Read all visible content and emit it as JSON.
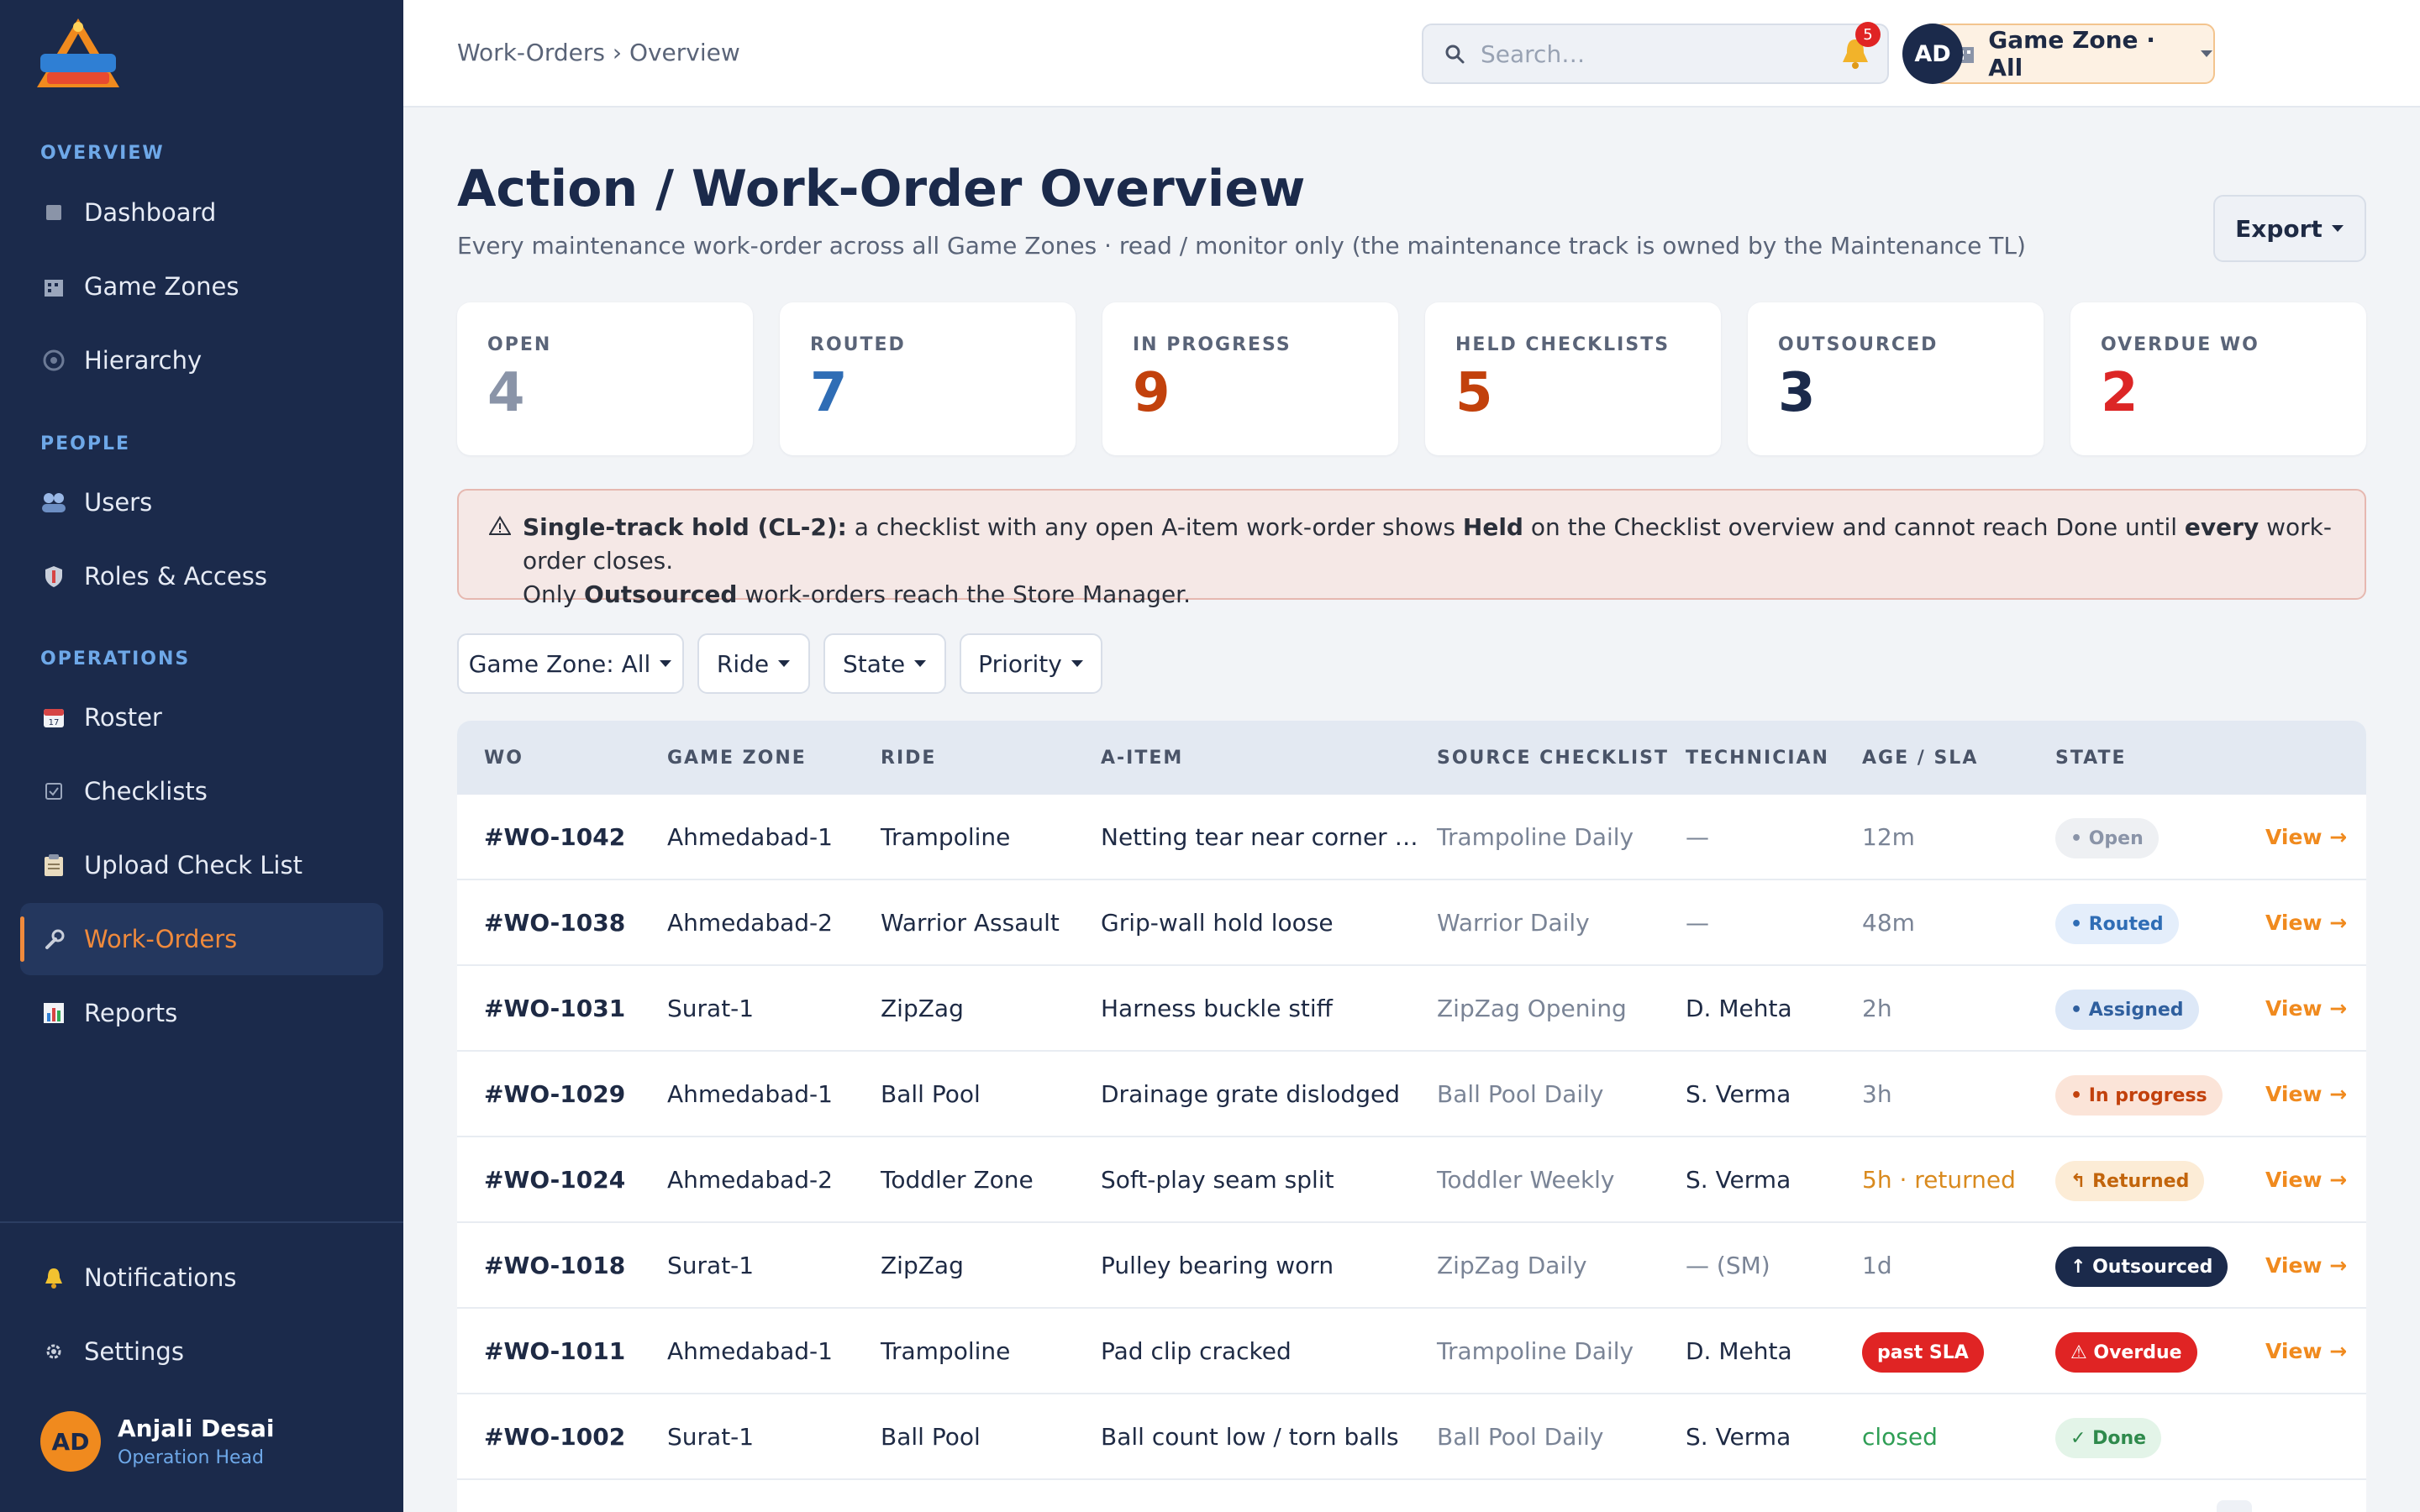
{
  "sidebar": {
    "sections": [
      {
        "title": "OVERVIEW"
      },
      {
        "title": "PEOPLE"
      },
      {
        "title": "OPERATIONS"
      }
    ],
    "items": [
      {
        "label": "Dashboard",
        "icon": "dashboard-icon"
      },
      {
        "label": "Game Zones",
        "icon": "building-icon"
      },
      {
        "label": "Hierarchy",
        "icon": "hierarchy-icon"
      },
      {
        "label": "Users",
        "icon": "users-icon"
      },
      {
        "label": "Roles & Access",
        "icon": "shield-icon"
      },
      {
        "label": "Roster",
        "icon": "calendar-icon"
      },
      {
        "label": "Checklists",
        "icon": "checkbox-icon"
      },
      {
        "label": "Upload Check List",
        "icon": "clipboard-icon"
      },
      {
        "label": "Work-Orders",
        "icon": "wrench-icon",
        "active": true
      },
      {
        "label": "Reports",
        "icon": "bar-chart-icon"
      }
    ],
    "bottom_items": [
      {
        "label": "Notifications",
        "icon": "bell-icon"
      },
      {
        "label": "Settings",
        "icon": "gear-icon"
      }
    ],
    "user": {
      "initials": "AD",
      "name": "Anjali Desai",
      "role": "Operation Head"
    }
  },
  "topbar": {
    "breadcrumb": "Work-Orders › Overview",
    "search_placeholder": "Search…",
    "zone_select": "Game Zone · All",
    "notification_count": "5",
    "avatar_initials": "AD"
  },
  "header": {
    "title": "Action / Work-Order Overview",
    "subtitle": "Every maintenance work-order across all Game Zones · read / monitor only (the maintenance track is owned by the Maintenance TL)",
    "export_label": "Export"
  },
  "stats": [
    {
      "label": "OPEN",
      "value": "4",
      "color": "#8a94a8"
    },
    {
      "label": "ROUTED",
      "value": "7",
      "color": "#2f6db5"
    },
    {
      "label": "IN PROGRESS",
      "value": "9",
      "color": "#c2410c"
    },
    {
      "label": "HELD CHECKLISTS",
      "value": "5",
      "color": "#c2410c"
    },
    {
      "label": "OUTSOURCED",
      "value": "3",
      "color": "#1b2a4b"
    },
    {
      "label": "OVERDUE WO",
      "value": "2",
      "color": "#dc2626"
    }
  ],
  "alert": {
    "bold1": "Single-track hold (CL-2):",
    "text1": " a checklist with any open A-item work-order shows ",
    "bold2": "Held",
    "text2": " on the Checklist overview and cannot reach Done until ",
    "bold3": "every",
    "text3": " work-order closes.",
    "text4": "Only ",
    "bold4": "Outsourced",
    "text5": " work-orders reach the Store Manager."
  },
  "filters": [
    {
      "label": "Game Zone: All"
    },
    {
      "label": "Ride"
    },
    {
      "label": "State"
    },
    {
      "label": "Priority"
    }
  ],
  "table": {
    "headers": [
      "WO",
      "GAME ZONE",
      "RIDE",
      "A-ITEM",
      "SOURCE CHECKLIST",
      "TECHNICIAN",
      "AGE / SLA",
      "STATE"
    ],
    "view_label": "View →",
    "rows": [
      {
        "wo": "#WO-1042",
        "zone": "Ahmedabad-1",
        "ride": "Trampoline",
        "item": "Netting tear near corner …",
        "source": "Trampoline Daily",
        "tech": "—",
        "age": "12m",
        "age_style": "plain",
        "state": "• Open",
        "state_style": "open"
      },
      {
        "wo": "#WO-1038",
        "zone": "Ahmedabad-2",
        "ride": "Warrior Assault",
        "item": "Grip-wall hold loose",
        "source": "Warrior Daily",
        "tech": "—",
        "age": "48m",
        "age_style": "plain",
        "state": "• Routed",
        "state_style": "routed"
      },
      {
        "wo": "#WO-1031",
        "zone": "Surat-1",
        "ride": "ZipZag",
        "item": "Harness buckle stiff",
        "source": "ZipZag Opening",
        "tech": "D. Mehta",
        "age": "2h",
        "age_style": "plain",
        "state": "• Assigned",
        "state_style": "assigned"
      },
      {
        "wo": "#WO-1029",
        "zone": "Ahmedabad-1",
        "ride": "Ball Pool",
        "item": "Drainage grate dislodged",
        "source": "Ball Pool Daily",
        "tech": "S. Verma",
        "age": "3h",
        "age_style": "plain",
        "state": "• In progress",
        "state_style": "inprogress"
      },
      {
        "wo": "#WO-1024",
        "zone": "Ahmedabad-2",
        "ride": "Toddler Zone",
        "item": "Soft-play seam split",
        "source": "Toddler Weekly",
        "tech": "S. Verma",
        "age": "5h · returned",
        "age_style": "returned",
        "state": "↰ Returned",
        "state_style": "returned"
      },
      {
        "wo": "#WO-1018",
        "zone": "Surat-1",
        "ride": "ZipZag",
        "item": "Pulley bearing worn",
        "source": "ZipZag Daily",
        "tech": "— (SM)",
        "age": "1d",
        "age_style": "plain",
        "state": "↑ Outsourced",
        "state_style": "outsourced"
      },
      {
        "wo": "#WO-1011",
        "zone": "Ahmedabad-1",
        "ride": "Trampoline",
        "item": "Pad clip cracked",
        "source": "Trampoline Daily",
        "tech": "D. Mehta",
        "age": "past SLA",
        "age_style": "pastsla",
        "state": "⚠ Overdue",
        "state_style": "overdue"
      },
      {
        "wo": "#WO-1002",
        "zone": "Surat-1",
        "ride": "Ball Pool",
        "item": "Ball count low / torn balls",
        "source": "Ball Pool Daily",
        "tech": "S. Verma",
        "age": "closed",
        "age_style": "closed",
        "state": "✓ Done",
        "state_style": "done"
      }
    ]
  }
}
